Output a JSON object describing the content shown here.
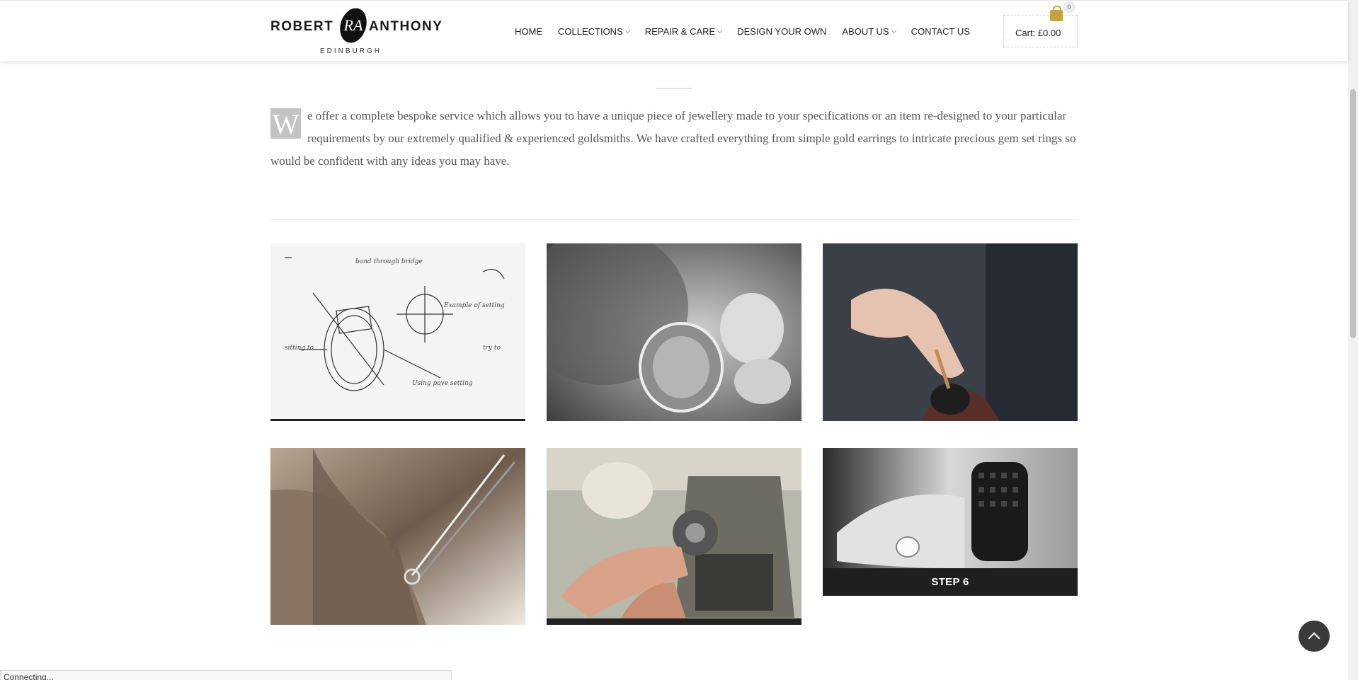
{
  "logo": {
    "left": "ROBERT",
    "right": "ANTHONY",
    "monogram": "RA",
    "city": "EDINBURGH"
  },
  "nav": {
    "items": [
      {
        "label": "HOME",
        "has_dropdown": false
      },
      {
        "label": "COLLECTIONS",
        "has_dropdown": true
      },
      {
        "label": "REPAIR & CARE",
        "has_dropdown": true
      },
      {
        "label": "DESIGN YOUR OWN",
        "has_dropdown": false
      },
      {
        "label": "ABOUT US",
        "has_dropdown": true
      },
      {
        "label": "CONTACT US",
        "has_dropdown": false
      }
    ]
  },
  "cart": {
    "label": "Cart: £0.00",
    "count": "0",
    "icon": "shopping-bag-icon",
    "accent": "#c8a03c"
  },
  "intro": {
    "dropcap": "W",
    "text": "e offer a complete bespoke service which allows you to have a unique piece of jewellery made to your specifications or an item re-designed to your particular requirements by our extremely qualified & experienced goldsmiths. We have crafted everything from simple gold earrings to intricate precious gem set rings so would be confident with any ideas you may have."
  },
  "steps": [
    {
      "image": "ring design sketch"
    },
    {
      "image": "loupe inspection"
    },
    {
      "image": "stone setting tool"
    },
    {
      "image": "tweezers holding ring"
    },
    {
      "image": "polishing wheel"
    },
    {
      "image": "finished diamond ring",
      "caption": "STEP 6"
    }
  ],
  "status_bar": {
    "text": "Connecting..."
  },
  "back_to_top": {
    "icon": "chevron-up-icon"
  }
}
